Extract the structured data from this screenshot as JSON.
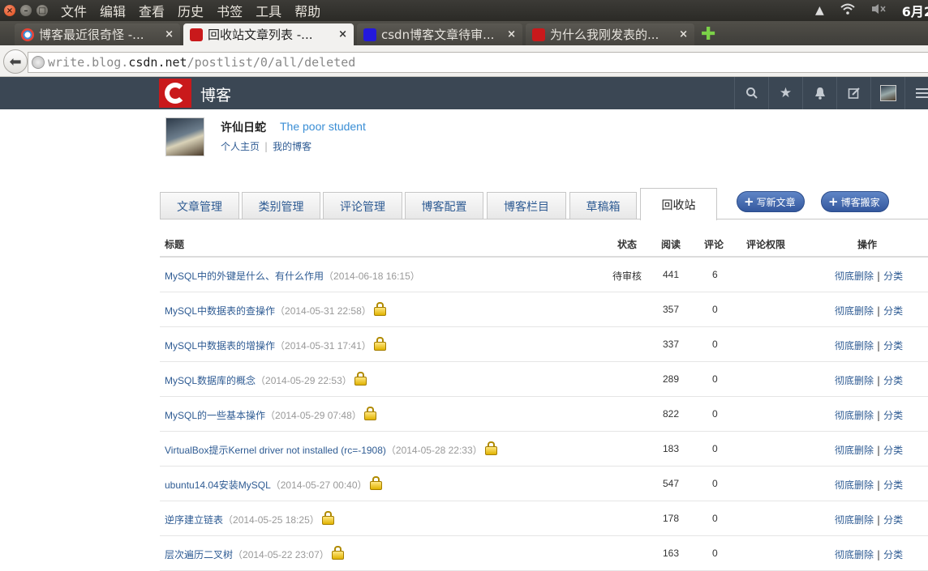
{
  "menubar": {
    "menus": [
      "文件",
      "编辑",
      "查看",
      "历史",
      "书签",
      "工具",
      "帮助"
    ],
    "clock": "6月2"
  },
  "tabs": [
    {
      "label": "博客最近很奇怪 -...",
      "icon": "chrome-icon"
    },
    {
      "label": "回收站文章列表 -...",
      "icon": "csdn-icon"
    },
    {
      "label": "csdn博客文章待审...",
      "icon": "baidu-icon"
    },
    {
      "label": "为什么我刚发表的...",
      "icon": "csdn-icon"
    }
  ],
  "address": {
    "prefix": "write.blog.",
    "domain": "csdn.net",
    "path": "/postlist/0/all/deleted"
  },
  "header": {
    "brand": "博客"
  },
  "profile": {
    "name": "许仙日蛇",
    "slogan": "The poor student",
    "link_home": "个人主页",
    "link_blog": "我的博客"
  },
  "mgmt_tabs": [
    "文章管理",
    "类别管理",
    "评论管理",
    "博客配置",
    "博客栏目",
    "草稿箱",
    "回收站"
  ],
  "buttons": {
    "write": "写新文章",
    "move": "博客搬家"
  },
  "table": {
    "headers": {
      "title": "标题",
      "status": "状态",
      "views": "阅读",
      "comments": "评论",
      "perm": "评论权限",
      "ops": "操作"
    },
    "op_delete": "彻底删除",
    "op_sep": "|",
    "op_category": "分类",
    "rows": [
      {
        "title": "MySQL中的外键是什么、有什么作用",
        "date": "（2014-06-18 16:15）",
        "locked": false,
        "status": "待审核",
        "views": "441",
        "comments": "6"
      },
      {
        "title": "MySQL中数据表的查操作",
        "date": "（2014-05-31 22:58）",
        "locked": true,
        "status": "",
        "views": "357",
        "comments": "0"
      },
      {
        "title": "MySQL中数据表的增操作",
        "date": "（2014-05-31 17:41）",
        "locked": true,
        "status": "",
        "views": "337",
        "comments": "0"
      },
      {
        "title": "MySQL数据库的概念",
        "date": "（2014-05-29 22:53）",
        "locked": true,
        "status": "",
        "views": "289",
        "comments": "0"
      },
      {
        "title": "MySQL的一些基本操作",
        "date": "（2014-05-29 07:48）",
        "locked": true,
        "status": "",
        "views": "822",
        "comments": "0"
      },
      {
        "title": "VirtualBox提示Kernel driver not installed (rc=-1908)",
        "date": "（2014-05-28 22:33）",
        "locked": true,
        "status": "",
        "views": "183",
        "comments": "0"
      },
      {
        "title": "ubuntu14.04安装MySQL",
        "date": "（2014-05-27 00:40）",
        "locked": true,
        "status": "",
        "views": "547",
        "comments": "0"
      },
      {
        "title": "逆序建立链表",
        "date": "（2014-05-25 18:25）",
        "locked": true,
        "status": "",
        "views": "178",
        "comments": "0"
      },
      {
        "title": "层次遍历二叉树",
        "date": "（2014-05-22 23:07）",
        "locked": true,
        "status": "",
        "views": "163",
        "comments": "0"
      }
    ]
  }
}
